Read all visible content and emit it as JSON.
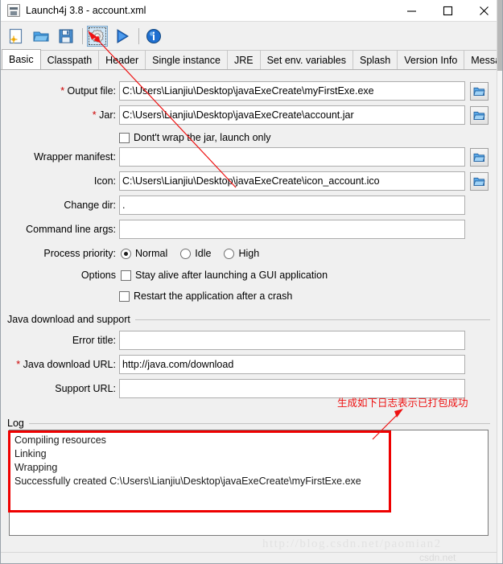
{
  "window": {
    "title": "Launch4j 3.8 - account.xml",
    "app_icon": "java-file-icon",
    "controls": [
      {
        "name": "minimize-button",
        "glyph": "minimize-icon"
      },
      {
        "name": "maximize-button",
        "glyph": "maximize-icon"
      },
      {
        "name": "close-button",
        "glyph": "close-icon"
      }
    ]
  },
  "toolbar": {
    "buttons": [
      {
        "name": "new-config-button",
        "icon": "new-document-icon",
        "selected": false
      },
      {
        "name": "open-config-button",
        "icon": "open-folder-icon",
        "selected": false
      },
      {
        "name": "save-config-button",
        "icon": "save-floppy-icon",
        "selected": false
      },
      {
        "name": "build-wrapper-button",
        "icon": "gear-build-icon",
        "selected": true
      },
      {
        "name": "test-wrapper-button",
        "icon": "play-run-icon",
        "selected": false
      },
      {
        "name": "about-button",
        "icon": "info-icon",
        "selected": false
      }
    ]
  },
  "tabs": {
    "active": "Basic",
    "items": [
      "Basic",
      "Classpath",
      "Header",
      "Single instance",
      "JRE",
      "Set env. variables",
      "Splash",
      "Version Info",
      "Messages"
    ]
  },
  "basic": {
    "output_file": {
      "label": "Output file:",
      "required": true,
      "value": "C:\\Users\\Lianjiu\\Desktop\\javaExeCreate\\myFirstExe.exe",
      "browse": "browse-folder-icon"
    },
    "jar": {
      "label": "Jar:",
      "required": true,
      "value": "C:\\Users\\Lianjiu\\Desktop\\javaExeCreate\\account.jar",
      "browse": "browse-folder-icon"
    },
    "dont_wrap": {
      "label": "Dont't wrap the jar, launch only",
      "checked": false
    },
    "wrapper_manifest": {
      "label": "Wrapper manifest:",
      "required": false,
      "value": "",
      "browse": "browse-folder-icon"
    },
    "icon": {
      "label": "Icon:",
      "required": false,
      "value": "C:\\Users\\Lianjiu\\Desktop\\javaExeCreate\\icon_account.ico",
      "browse": "browse-folder-icon"
    },
    "change_dir": {
      "label": "Change dir:",
      "required": false,
      "value": "."
    },
    "command_line_args": {
      "label": "Command line args:",
      "required": false,
      "value": ""
    },
    "process_priority": {
      "label": "Process priority:",
      "selected": "Normal",
      "options": [
        "Normal",
        "Idle",
        "High"
      ]
    },
    "options": {
      "label": "Options",
      "items": [
        {
          "label": "Stay alive after launching a GUI application",
          "checked": false
        },
        {
          "label": "Restart the application after a crash",
          "checked": false
        }
      ]
    }
  },
  "java_support": {
    "group_title": "Java download and support",
    "error_title": {
      "label": "Error title:",
      "required": false,
      "value": ""
    },
    "java_download_url": {
      "label": "Java download URL:",
      "required": true,
      "value": "http://java.com/download"
    },
    "support_url": {
      "label": "Support URL:",
      "required": false,
      "value": ""
    }
  },
  "log": {
    "group_title": "Log",
    "lines": [
      "Compiling resources",
      "Linking",
      "Wrapping",
      "Successfully created C:\\Users\\Lianjiu\\Desktop\\javaExeCreate\\myFirstExe.exe"
    ]
  },
  "annotations": {
    "note_text": "生成如下日志表示已打包成功",
    "color": "#ee1111"
  },
  "watermarks": {
    "url": "http://blog.csdn.net/paomian2",
    "corner": "csdn.net"
  }
}
